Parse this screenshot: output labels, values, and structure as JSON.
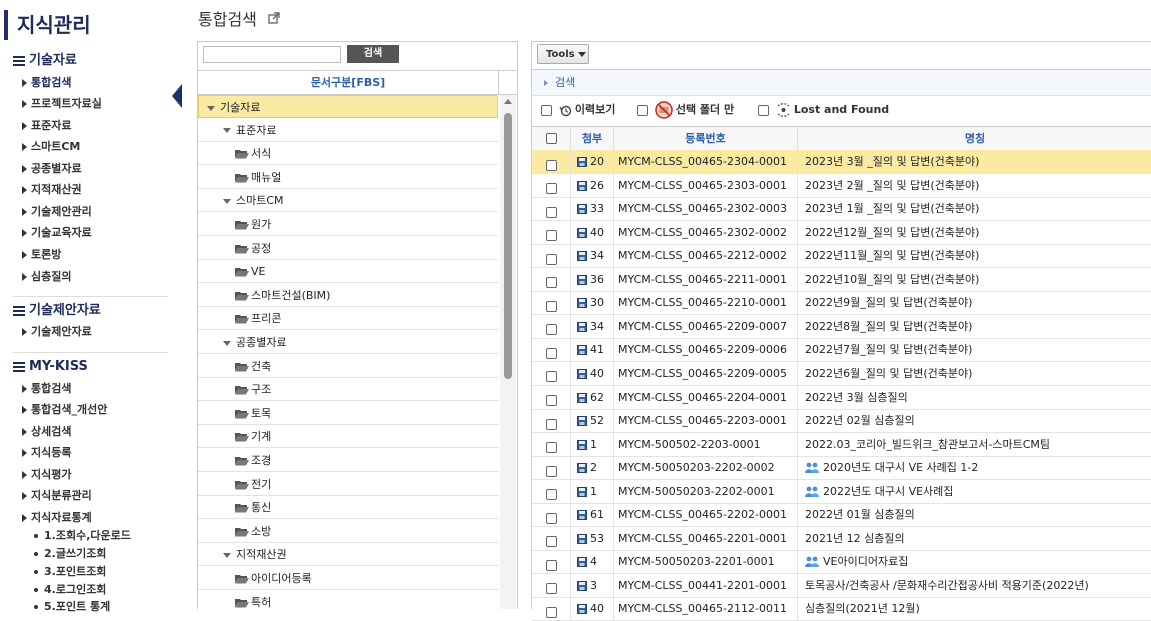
{
  "app_title": "지식관리",
  "page": {
    "title": "통합검색"
  },
  "sidebar": {
    "sections": [
      {
        "title": "기술자료",
        "items": [
          "통합검색",
          "프로젝트자료실",
          "표준자료",
          "스마트CM",
          "공종별자료",
          "지적재산권",
          "기술제안관리",
          "기술교육자료",
          "토론방",
          "심층질의"
        ]
      },
      {
        "title": "기술제안자료",
        "items": [
          "기술제안자료"
        ]
      },
      {
        "title": "MY-KISS",
        "items": [
          "통합검색",
          "통합검색_개선안",
          "상세검색",
          "지식등록",
          "지식평가",
          "지식분류관리",
          "지식자료통계"
        ],
        "subitems": [
          "1.조회수,다운로드",
          "2.글쓰기조회",
          "3.포인트조회",
          "4.로그인조회",
          "5.포인트 통계"
        ]
      }
    ]
  },
  "tree": {
    "search_placeholder": "",
    "search_button": "검색",
    "header": "문서구분[FBS]",
    "nodes": [
      {
        "label": "기술자료",
        "level": 0,
        "type": "expander",
        "selected": true
      },
      {
        "label": "표준자료",
        "level": 1,
        "type": "expander"
      },
      {
        "label": "서식",
        "level": 2,
        "type": "folder"
      },
      {
        "label": "매뉴얼",
        "level": 2,
        "type": "folder"
      },
      {
        "label": "스마트CM",
        "level": 1,
        "type": "expander"
      },
      {
        "label": "원가",
        "level": 2,
        "type": "folder"
      },
      {
        "label": "공정",
        "level": 2,
        "type": "folder"
      },
      {
        "label": "VE",
        "level": 2,
        "type": "folder"
      },
      {
        "label": "스마트건설(BIM)",
        "level": 2,
        "type": "folder"
      },
      {
        "label": "프리콘",
        "level": 2,
        "type": "folder"
      },
      {
        "label": "공종별자료",
        "level": 1,
        "type": "expander"
      },
      {
        "label": "건축",
        "level": 2,
        "type": "folder"
      },
      {
        "label": "구조",
        "level": 2,
        "type": "folder"
      },
      {
        "label": "토목",
        "level": 2,
        "type": "folder"
      },
      {
        "label": "기계",
        "level": 2,
        "type": "folder"
      },
      {
        "label": "조경",
        "level": 2,
        "type": "folder"
      },
      {
        "label": "전기",
        "level": 2,
        "type": "folder"
      },
      {
        "label": "통신",
        "level": 2,
        "type": "folder"
      },
      {
        "label": "소방",
        "level": 2,
        "type": "folder"
      },
      {
        "label": "지적재산권",
        "level": 1,
        "type": "expander"
      },
      {
        "label": "아이디어등록",
        "level": 2,
        "type": "folder"
      },
      {
        "label": "특허",
        "level": 2,
        "type": "folder"
      }
    ]
  },
  "right": {
    "tools_label": "Tools",
    "search_section_label": "검색",
    "filters": {
      "history": "이력보기",
      "selected_folder": "선택 폴더 만",
      "lost_found": "Lost and Found"
    },
    "columns": {
      "attach": "첨부",
      "reg_no": "등록번호",
      "name": "명칭"
    },
    "rows": [
      {
        "attach": "20",
        "reg_no": "MYCM-CLSS_00465-2304-0001",
        "name": "2023년 3월 _질의 및 답변(건축분야)",
        "icon": "",
        "selected": true
      },
      {
        "attach": "26",
        "reg_no": "MYCM-CLSS_00465-2303-0001",
        "name": "2023년 2월 _질의 및 답변(건축분야)",
        "icon": ""
      },
      {
        "attach": "33",
        "reg_no": "MYCM-CLSS_00465-2302-0003",
        "name": "2023년 1월 _질의 및 답변(건축분야)",
        "icon": ""
      },
      {
        "attach": "40",
        "reg_no": "MYCM-CLSS_00465-2302-0002",
        "name": "2022년12월_질의 및 답변(건축분야)",
        "icon": ""
      },
      {
        "attach": "34",
        "reg_no": "MYCM-CLSS_00465-2212-0002",
        "name": "2022년11월_질의 및 답변(건축분야)",
        "icon": ""
      },
      {
        "attach": "36",
        "reg_no": "MYCM-CLSS_00465-2211-0001",
        "name": "2022년10월_질의 및 답변(건축분야)",
        "icon": ""
      },
      {
        "attach": "30",
        "reg_no": "MYCM-CLSS_00465-2210-0001",
        "name": "2022년9월_질의 및 답변(건축분야)",
        "icon": ""
      },
      {
        "attach": "34",
        "reg_no": "MYCM-CLSS_00465-2209-0007",
        "name": "2022년8월_질의 및 답변(건축분야)",
        "icon": ""
      },
      {
        "attach": "41",
        "reg_no": "MYCM-CLSS_00465-2209-0006",
        "name": "2022년7월_질의 및 답변(건축분야)",
        "icon": ""
      },
      {
        "attach": "40",
        "reg_no": "MYCM-CLSS_00465-2209-0005",
        "name": "2022년6월_질의 및 답변(건축분야)",
        "icon": ""
      },
      {
        "attach": "62",
        "reg_no": "MYCM-CLSS_00465-2204-0001",
        "name": "2022년 3월 심층질의",
        "icon": ""
      },
      {
        "attach": "52",
        "reg_no": "MYCM-CLSS_00465-2203-0001",
        "name": "2022년 02월 심층질의",
        "icon": ""
      },
      {
        "attach": "1",
        "reg_no": "MYCM-500502-2203-0001",
        "name": "2022.03_코리아_빌드위크_참관보고서-스마트CM팀",
        "icon": ""
      },
      {
        "attach": "2",
        "reg_no": "MYCM-50050203-2202-0002",
        "name": "2020년도 대구시 VE 사례집 1-2",
        "icon": "people"
      },
      {
        "attach": "1",
        "reg_no": "MYCM-50050203-2202-0001",
        "name": "2022년도 대구시 VE사례집",
        "icon": "people"
      },
      {
        "attach": "61",
        "reg_no": "MYCM-CLSS_00465-2202-0001",
        "name": "2022년 01월 심층질의",
        "icon": ""
      },
      {
        "attach": "53",
        "reg_no": "MYCM-CLSS_00465-2201-0001",
        "name": "2021년 12 심층질의",
        "icon": ""
      },
      {
        "attach": "4",
        "reg_no": "MYCM-50050203-2201-0001",
        "name": "VE아이디어자료집",
        "icon": "people"
      },
      {
        "attach": "3",
        "reg_no": "MYCM-CLSS_00441-2201-0001",
        "name": "토목공사/건축공사 /문화재수리간접공사비 적용기준(2022년)",
        "icon": ""
      },
      {
        "attach": "40",
        "reg_no": "MYCM-CLSS_00465-2112-0011",
        "name": "심층질의(2021년 12월)",
        "icon": ""
      }
    ]
  },
  "colors": {
    "accent": "#2c5fa8",
    "selected_row": "#fbeaa2",
    "navy": "#1e2a5a"
  }
}
